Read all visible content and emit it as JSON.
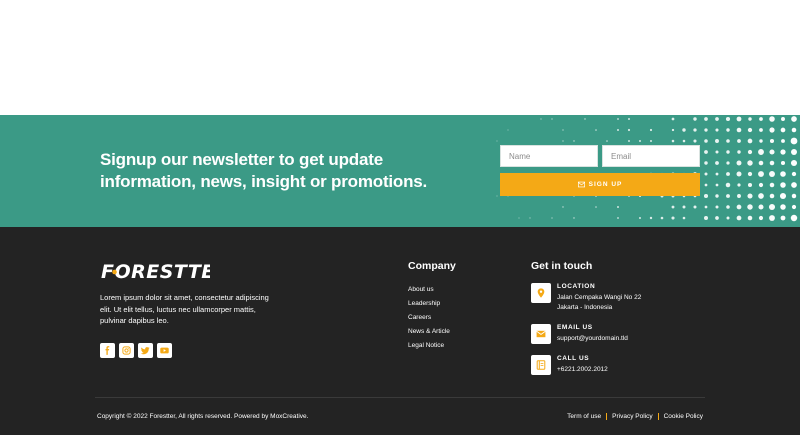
{
  "newsletter": {
    "headline": "Signup our newsletter to get update information, news, insight or promotions.",
    "name_placeholder": "Name",
    "email_placeholder": "Email",
    "button_label": "SIGN UP"
  },
  "footer": {
    "brand": "FORESTTER",
    "about": "Lorem ipsum dolor sit amet, consectetur adipiscing elit. Ut elit tellus, luctus nec ullamcorper mattis, pulvinar dapibus leo.",
    "socials": [
      "facebook-icon",
      "instagram-icon",
      "twitter-icon",
      "youtube-icon"
    ],
    "company": {
      "title": "Company",
      "links": [
        "About us",
        "Leadership",
        "Careers",
        "News & Article",
        "Legal Notice"
      ]
    },
    "contact": {
      "title": "Get in touch",
      "location_label": "LOCATION",
      "location_line1": "Jalan Cempaka Wangi No 22",
      "location_line2": "Jakarta - Indonesia",
      "email_label": "EMAIL US",
      "email_value": "support@yourdomain.tld",
      "call_label": "CALL US",
      "call_value": "+6221.2002.2012"
    },
    "copyright": "Copyright © 2022 Forestter, All rights reserved. Powered by MoxCreative.",
    "legal_links": [
      "Term of use",
      "Privacy Policy",
      "Cookie Policy"
    ]
  },
  "colors": {
    "teal": "#3b9a86",
    "accent": "#f4a916",
    "footer_bg": "#232323"
  }
}
